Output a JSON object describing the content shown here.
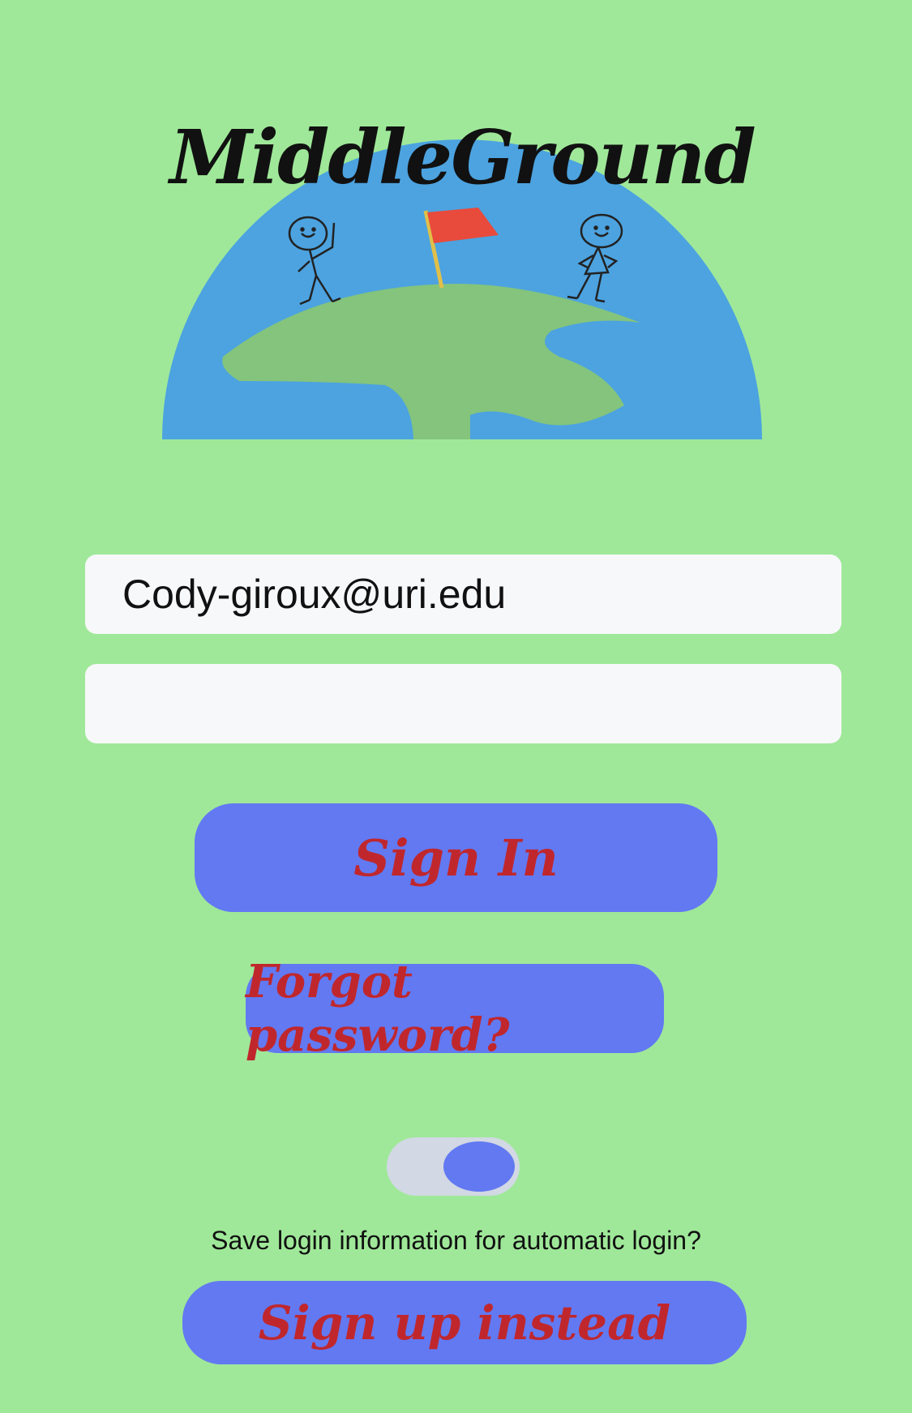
{
  "app": {
    "logo_text": "MiddleGround"
  },
  "login": {
    "email_value": "Cody-giroux@uri.edu",
    "password_value": ""
  },
  "buttons": {
    "sign_in": "Sign In",
    "forgot_password": "Forgot password?",
    "sign_up": "Sign up instead"
  },
  "save_login": {
    "label": "Save login information for automatic login?",
    "enabled": true
  },
  "colors": {
    "background": "#9fe899",
    "button": "#6279f2",
    "button_text": "#c0272d",
    "field": "#f7f8fa"
  }
}
